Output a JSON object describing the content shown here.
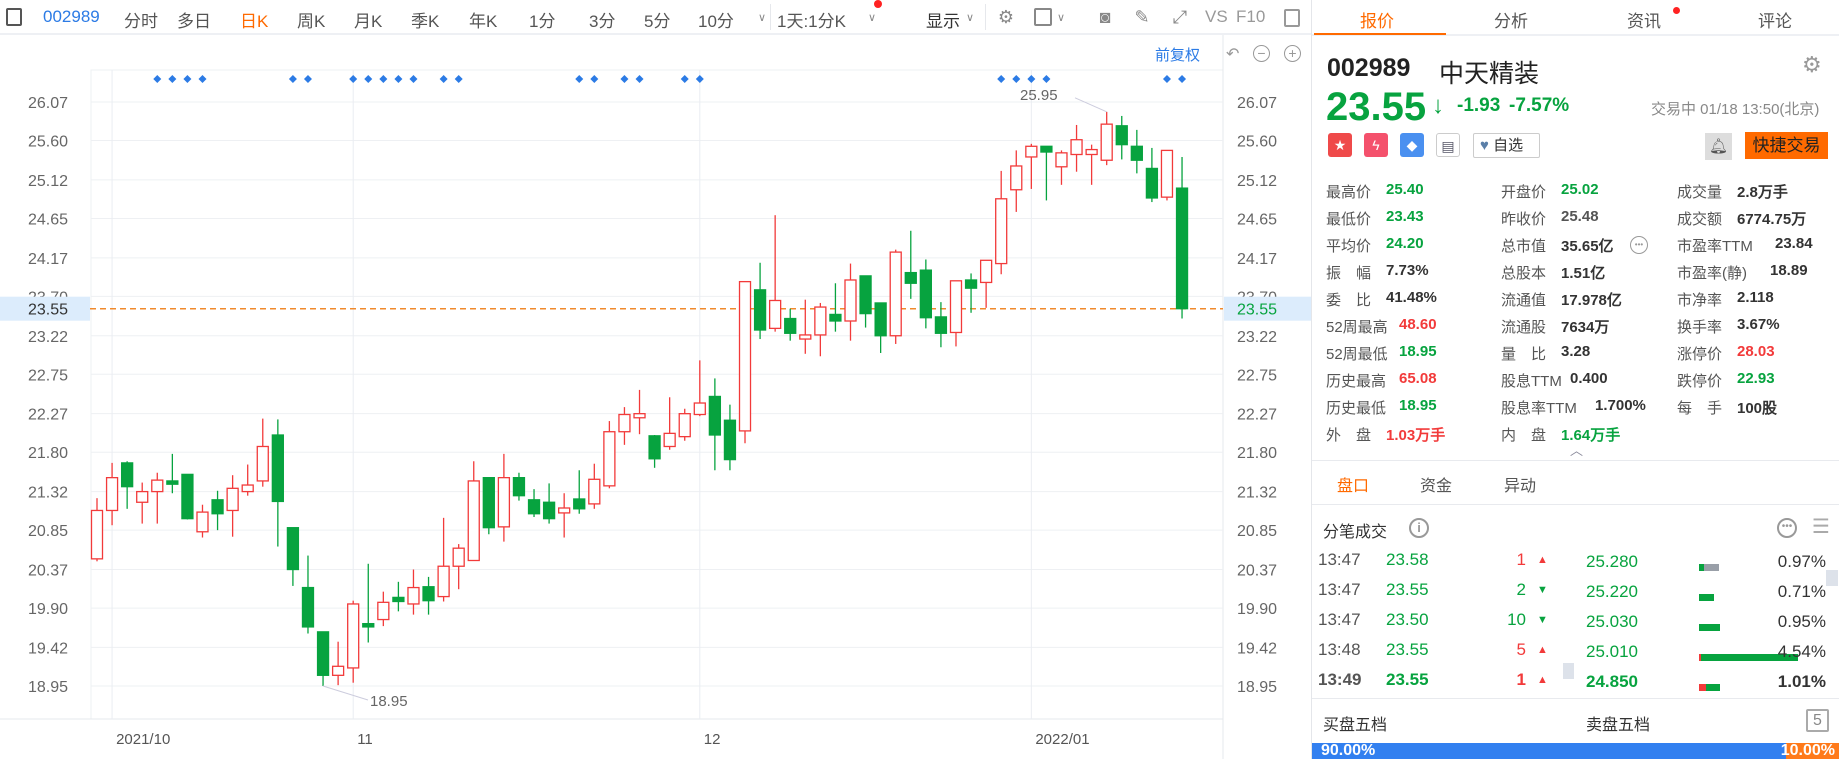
{
  "toolbar": {
    "code": "002989",
    "periods": [
      "分时",
      "多日",
      "日K",
      "周K",
      "月K",
      "季K",
      "年K",
      "1分",
      "3分",
      "5分",
      "10分"
    ],
    "active_period": "日K",
    "interval_select": "1天:1分K",
    "display_label": "显示",
    "vs_label": "VS",
    "f10_label": "F10"
  },
  "chart_controls": {
    "adjust_label": "前复权"
  },
  "chart_data": {
    "type": "candlestick",
    "title": "002989 日K",
    "y_ticks": [
      "26.07",
      "25.60",
      "25.12",
      "24.65",
      "24.17",
      "23.70",
      "23.22",
      "22.75",
      "22.27",
      "21.80",
      "21.32",
      "20.85",
      "20.37",
      "19.90",
      "19.42",
      "18.95"
    ],
    "ylim": [
      18.95,
      26.07
    ],
    "x_labels": [
      {
        "label": "2021/10",
        "index": 1
      },
      {
        "label": "11",
        "index": 17
      },
      {
        "label": "12",
        "index": 40
      },
      {
        "label": "2022/01",
        "index": 62
      }
    ],
    "current_price": "23.55",
    "max_annotation": {
      "label": "25.95",
      "index": 67
    },
    "min_annotation": {
      "label": "18.95",
      "index": 15
    },
    "marker_indices": [
      4,
      5,
      6,
      7,
      13,
      14,
      17,
      18,
      19,
      20,
      21,
      23,
      24,
      32,
      33,
      35,
      36,
      39,
      40,
      60,
      61,
      62,
      63,
      71,
      72
    ],
    "ohlc": [
      [
        20.5,
        21.24,
        20.47,
        21.09
      ],
      [
        21.09,
        21.67,
        20.91,
        21.49
      ],
      [
        21.67,
        21.69,
        21.11,
        21.38
      ],
      [
        21.19,
        21.43,
        20.93,
        21.32
      ],
      [
        21.32,
        21.55,
        20.93,
        21.46
      ],
      [
        21.45,
        21.78,
        21.3,
        21.41
      ],
      [
        21.53,
        21.53,
        20.98,
        20.99
      ],
      [
        20.83,
        21.16,
        20.76,
        21.07
      ],
      [
        21.22,
        21.33,
        20.85,
        21.05
      ],
      [
        21.09,
        21.52,
        20.77,
        21.36
      ],
      [
        21.32,
        21.65,
        21.27,
        21.4
      ],
      [
        21.45,
        22.21,
        21.38,
        21.87
      ],
      [
        22.01,
        22.2,
        20.65,
        21.2
      ],
      [
        20.88,
        20.88,
        20.17,
        20.37
      ],
      [
        20.15,
        20.54,
        19.59,
        19.67
      ],
      [
        19.61,
        19.61,
        18.95,
        19.08
      ],
      [
        19.08,
        19.49,
        18.96,
        19.19
      ],
      [
        19.17,
        19.99,
        18.99,
        19.95
      ],
      [
        19.71,
        20.44,
        19.48,
        19.67
      ],
      [
        19.76,
        20.1,
        19.68,
        19.97
      ],
      [
        20.03,
        20.22,
        19.86,
        19.98
      ],
      [
        19.95,
        20.37,
        19.82,
        20.15
      ],
      [
        20.16,
        20.28,
        19.82,
        19.99
      ],
      [
        20.04,
        21.0,
        19.98,
        20.41
      ],
      [
        20.41,
        20.68,
        20.13,
        20.63
      ],
      [
        20.48,
        21.69,
        20.48,
        21.45
      ],
      [
        21.49,
        21.49,
        20.8,
        20.88
      ],
      [
        20.89,
        21.78,
        20.71,
        21.49
      ],
      [
        21.49,
        21.55,
        21.21,
        21.27
      ],
      [
        21.22,
        21.35,
        21.01,
        21.05
      ],
      [
        21.19,
        21.42,
        20.93,
        20.99
      ],
      [
        21.06,
        21.3,
        20.76,
        21.12
      ],
      [
        21.23,
        21.58,
        21.05,
        21.11
      ],
      [
        21.17,
        21.66,
        21.11,
        21.47
      ],
      [
        21.39,
        22.18,
        21.36,
        22.05
      ],
      [
        22.05,
        22.35,
        21.89,
        22.26
      ],
      [
        22.22,
        22.56,
        22.02,
        22.27
      ],
      [
        22.0,
        22.01,
        21.61,
        21.72
      ],
      [
        21.87,
        22.47,
        21.83,
        22.03
      ],
      [
        21.99,
        22.33,
        21.94,
        22.27
      ],
      [
        22.26,
        22.92,
        22.24,
        22.4
      ],
      [
        22.48,
        22.7,
        21.58,
        22.01
      ],
      [
        22.19,
        22.38,
        21.58,
        21.71
      ],
      [
        22.06,
        23.88,
        21.91,
        23.88
      ],
      [
        23.78,
        24.11,
        23.18,
        23.29
      ],
      [
        23.31,
        24.69,
        23.27,
        23.65
      ],
      [
        23.43,
        23.55,
        23.16,
        23.25
      ],
      [
        23.18,
        23.66,
        23.0,
        23.23
      ],
      [
        23.23,
        23.62,
        22.97,
        23.57
      ],
      [
        23.48,
        23.86,
        23.27,
        23.4
      ],
      [
        23.4,
        24.1,
        23.16,
        23.9
      ],
      [
        23.95,
        23.95,
        23.32,
        23.49
      ],
      [
        23.62,
        23.62,
        23.01,
        23.22
      ],
      [
        23.22,
        24.27,
        23.12,
        24.24
      ],
      [
        23.99,
        24.5,
        23.67,
        23.86
      ],
      [
        24.02,
        24.15,
        23.31,
        23.44
      ],
      [
        23.45,
        23.63,
        23.08,
        23.25
      ],
      [
        23.26,
        23.89,
        23.09,
        23.89
      ],
      [
        23.9,
        23.98,
        23.5,
        23.8
      ],
      [
        23.87,
        24.14,
        23.56,
        24.14
      ],
      [
        24.1,
        25.23,
        23.97,
        24.89
      ],
      [
        25.0,
        25.48,
        24.73,
        25.29
      ],
      [
        25.4,
        25.56,
        25.01,
        25.53
      ],
      [
        25.53,
        25.53,
        24.87,
        25.46
      ],
      [
        25.28,
        25.48,
        25.06,
        25.45
      ],
      [
        25.43,
        25.79,
        25.22,
        25.61
      ],
      [
        25.43,
        25.55,
        25.06,
        25.49
      ],
      [
        25.36,
        25.95,
        25.3,
        25.8
      ],
      [
        25.78,
        25.9,
        25.37,
        25.55
      ],
      [
        25.53,
        25.73,
        25.2,
        25.36
      ],
      [
        25.26,
        25.51,
        24.85,
        24.9
      ],
      [
        24.91,
        25.48,
        24.87,
        25.48
      ],
      [
        25.02,
        25.4,
        23.43,
        23.55
      ]
    ],
    "colors": {
      "up": "#f23a3a",
      "down": "#07a33f",
      "marker": "#2c7be5",
      "price_line": "#f08a2c"
    }
  },
  "right": {
    "tabs": [
      "报价",
      "分析",
      "资讯",
      "评论"
    ],
    "code": "002989",
    "name": "中天精装",
    "price": "23.55",
    "change": "-1.93",
    "change_pct": "-7.57%",
    "status": "交易中 01/18 13:50(北京)",
    "watch_label": "自选",
    "trade_label": "快捷交易",
    "quote": [
      [
        {
          "l": "最高价",
          "v": "25.40",
          "c": "g"
        },
        {
          "l": "开盘价",
          "v": "25.02",
          "c": "g"
        },
        {
          "l": "成交量",
          "v": "2.8万手",
          "c": ""
        }
      ],
      [
        {
          "l": "最低价",
          "v": "23.43",
          "c": "g"
        },
        {
          "l": "昨收价",
          "v": "25.48",
          "c": "gr"
        },
        {
          "l": "成交额",
          "v": "6774.75万",
          "c": ""
        }
      ],
      [
        {
          "l": "平均价",
          "v": "24.20",
          "c": "g"
        },
        {
          "l": "总市值",
          "v": "35.65亿",
          "c": ""
        },
        {
          "l": "市盈率TTM",
          "v": "23.84",
          "c": ""
        }
      ],
      [
        {
          "l": "振　幅",
          "v": "7.73%",
          "c": ""
        },
        {
          "l": "总股本",
          "v": "1.51亿",
          "c": ""
        },
        {
          "l": "市盈率(静)",
          "v": "18.89",
          "c": ""
        }
      ],
      [
        {
          "l": "委　比",
          "v": "41.48%",
          "c": ""
        },
        {
          "l": "流通值",
          "v": "17.978亿",
          "c": ""
        },
        {
          "l": "市净率",
          "v": "2.118",
          "c": ""
        }
      ],
      [
        {
          "l": "52周最高",
          "v": "48.60",
          "c": "r"
        },
        {
          "l": "流通股",
          "v": "7634万",
          "c": ""
        },
        {
          "l": "换手率",
          "v": "3.67%",
          "c": ""
        }
      ],
      [
        {
          "l": "52周最低",
          "v": "18.95",
          "c": "g"
        },
        {
          "l": "量　比",
          "v": "3.28",
          "c": ""
        },
        {
          "l": "涨停价",
          "v": "28.03",
          "c": "r"
        }
      ],
      [
        {
          "l": "历史最高",
          "v": "65.08",
          "c": "r"
        },
        {
          "l": "股息TTM",
          "v": "0.400",
          "c": ""
        },
        {
          "l": "跌停价",
          "v": "22.93",
          "c": "g"
        }
      ],
      [
        {
          "l": "历史最低",
          "v": "18.95",
          "c": "g"
        },
        {
          "l": "股息率TTM",
          "v": "1.700%",
          "c": ""
        },
        {
          "l": "每　手",
          "v": "100股",
          "c": ""
        }
      ],
      [
        {
          "l": "外　盘",
          "v": "1.03万手",
          "c": "r"
        },
        {
          "l": "内　盘",
          "v": "1.64万手",
          "c": "g"
        }
      ]
    ],
    "subtabs": [
      "盘口",
      "资金",
      "异动"
    ],
    "ticks_title": "分笔成交",
    "ticks": [
      {
        "time": "13:47",
        "price": "23.58",
        "vol": "1",
        "dir": "up"
      },
      {
        "time": "13:47",
        "price": "23.55",
        "vol": "2",
        "dir": "down"
      },
      {
        "time": "13:47",
        "price": "23.50",
        "vol": "10",
        "dir": "down"
      },
      {
        "time": "13:48",
        "price": "23.55",
        "vol": "5",
        "dir": "up"
      },
      {
        "time": "13:49",
        "price": "23.55",
        "vol": "1",
        "dir": "up"
      }
    ],
    "dist": [
      {
        "price": "25.280",
        "pct": "0.97%",
        "red": 0,
        "green": 0.05,
        "gray": 0.15
      },
      {
        "price": "25.220",
        "pct": "0.71%",
        "red": 0,
        "green": 0.15,
        "gray": 0
      },
      {
        "price": "25.030",
        "pct": "0.95%",
        "red": 0,
        "green": 0.21,
        "gray": 0
      },
      {
        "price": "25.010",
        "pct": "4.54%",
        "red": 0.02,
        "green": 0.97,
        "gray": 0
      },
      {
        "price": "24.850",
        "pct": "1.01%",
        "red": 0.07,
        "green": 0.14,
        "gray": 0
      }
    ],
    "bid_title": "买盘五档",
    "ask_title": "卖盘五档",
    "levels_badge": "5",
    "bid_pct": "90.00%",
    "ask_pct": "10.00%",
    "bid_ratio": 0.9
  }
}
